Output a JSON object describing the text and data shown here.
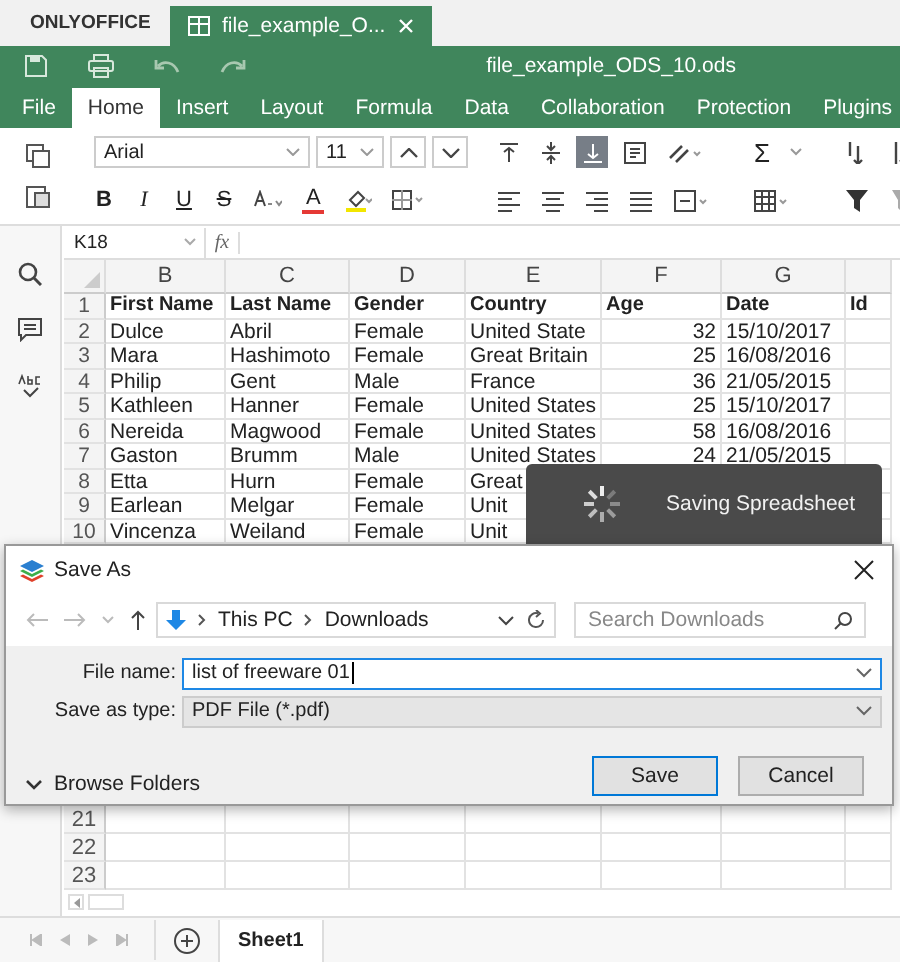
{
  "app_tabs": {
    "brand": "ONLYOFFICE",
    "document_tab": {
      "title": "file_example_O...",
      "selected": true
    }
  },
  "header": {
    "file_name": "file_example_ODS_10.ods"
  },
  "menu": [
    {
      "label": "File",
      "selected": false
    },
    {
      "label": "Home",
      "selected": true
    },
    {
      "label": "Insert",
      "selected": false
    },
    {
      "label": "Layout",
      "selected": false
    },
    {
      "label": "Formula",
      "selected": false
    },
    {
      "label": "Data",
      "selected": false
    },
    {
      "label": "Collaboration",
      "selected": false
    },
    {
      "label": "Protection",
      "selected": false
    },
    {
      "label": "Plugins",
      "selected": false
    }
  ],
  "toolbar": {
    "font": "Arial",
    "font_size": "11",
    "text_styles": [
      "B",
      "I",
      "U",
      "S"
    ],
    "font_color_letter": "A",
    "sum": "Σ",
    "valign": [
      {
        "kind": "top",
        "selected": false
      },
      {
        "kind": "middle",
        "selected": false
      },
      {
        "kind": "bottom",
        "selected": true
      }
    ]
  },
  "formula_bar": {
    "cell": "K18",
    "fx": "fx"
  },
  "sheet": {
    "columns": [
      "B",
      "C",
      "D",
      "E",
      "F",
      "G"
    ],
    "header_row": {
      "number": "1",
      "cells": [
        "First Name",
        "Last Name",
        "Gender",
        "Country",
        "Age",
        "Date",
        "Id"
      ]
    },
    "rows": [
      {
        "number": "2",
        "cells": [
          "Dulce",
          "Abril",
          "Female",
          "United State",
          "32",
          "15/10/2017"
        ]
      },
      {
        "number": "3",
        "cells": [
          "Mara",
          "Hashimoto",
          "Female",
          "Great Britain",
          "25",
          "16/08/2016"
        ]
      },
      {
        "number": "4",
        "cells": [
          "Philip",
          "Gent",
          "Male",
          "France",
          "36",
          "21/05/2015"
        ]
      },
      {
        "number": "5",
        "cells": [
          "Kathleen",
          "Hanner",
          "Female",
          "United States",
          "25",
          "15/10/2017"
        ]
      },
      {
        "number": "6",
        "cells": [
          "Nereida",
          "Magwood",
          "Female",
          "United States",
          "58",
          "16/08/2016"
        ]
      },
      {
        "number": "7",
        "cells": [
          "Gaston",
          "Brumm",
          "Male",
          "United States",
          "24",
          "21/05/2015"
        ]
      },
      {
        "number": "8",
        "cells": [
          "Etta",
          "Hurn",
          "Female",
          "Great"
        ]
      },
      {
        "number": "9",
        "cells": [
          "Earlean",
          "Melgar",
          "Female",
          "Unit"
        ]
      },
      {
        "number": "10",
        "cells": [
          "Vincenza",
          "Weiland",
          "Female",
          "Unit"
        ]
      }
    ],
    "bottom_rows": [
      "21",
      "22",
      "23"
    ]
  },
  "saving": {
    "text": "Saving Spreadsheet"
  },
  "dialog": {
    "title": "Save As",
    "path": [
      "This PC",
      "Downloads"
    ],
    "search_placeholder": "Search Downloads",
    "fields": [
      {
        "label": "File name:",
        "value": "list of freeware 01",
        "kind": "input"
      },
      {
        "label": "Save as type:",
        "value": "PDF File (*.pdf)",
        "kind": "select"
      }
    ],
    "browse": "Browse Folders",
    "buttons": [
      {
        "label": "Save",
        "default": true
      },
      {
        "label": "Cancel",
        "default": false
      }
    ]
  },
  "sheet_tabs": [
    {
      "label": "Sheet1",
      "selected": true
    }
  ]
}
